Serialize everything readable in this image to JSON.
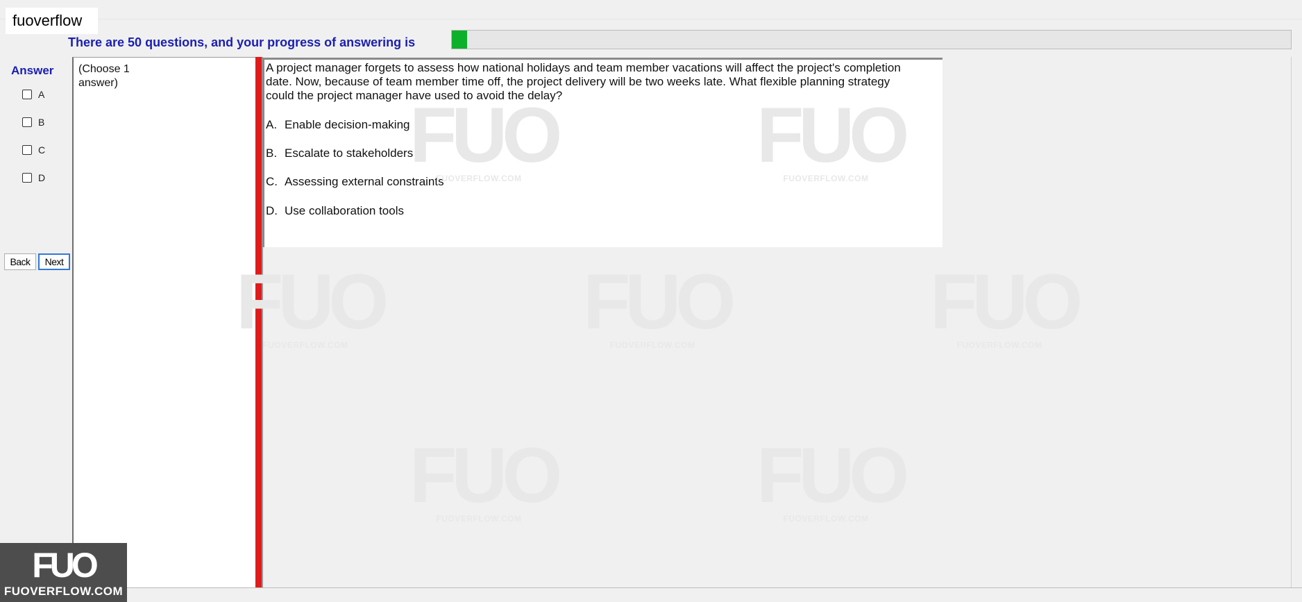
{
  "window": {
    "title": "fuoverflow"
  },
  "progress": {
    "label": "There are 50 questions, and your progress of answering is",
    "fraction": 0.018,
    "fill_color": "#0db02b"
  },
  "answer": {
    "heading": "Answer",
    "options": [
      "A",
      "B",
      "C",
      "D"
    ]
  },
  "nav": {
    "back_label": "Back",
    "next_label": "Next"
  },
  "instructions": "(Choose 1 answer)",
  "question": {
    "text": "A project manager forgets to assess how national holidays and team member vacations will affect the project's completion date. Now, because of team member time off, the project delivery will be two weeks late. What flexible planning strategy could the project manager have used to avoid the delay?",
    "choices": [
      {
        "letter": "A.",
        "text": "Enable decision-making"
      },
      {
        "letter": "B.",
        "text": "Escalate to stakeholders"
      },
      {
        "letter": "C.",
        "text": "Assessing external constraints"
      },
      {
        "letter": "D.",
        "text": "Use collaboration tools"
      }
    ]
  },
  "watermark": {
    "mark": "FUO",
    "text": "FUOVERFLOW.COM"
  },
  "logo": {
    "mark": "FUO",
    "text": "FUOVERFLOW.COM"
  },
  "colors": {
    "accent": "#1a1fb0",
    "separator": "#e01b1b"
  }
}
